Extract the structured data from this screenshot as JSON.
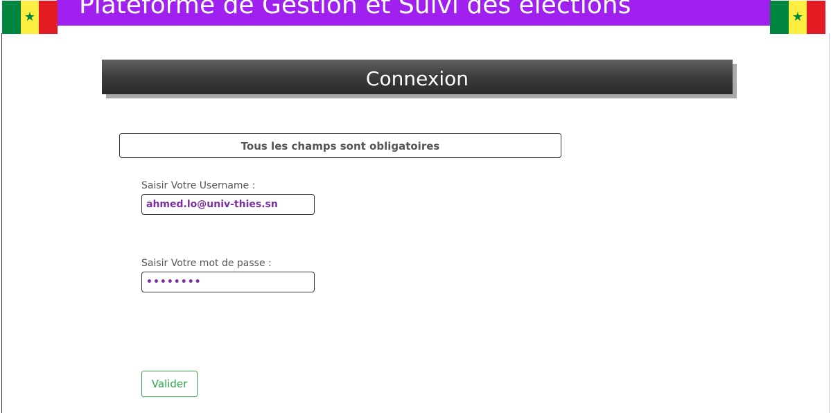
{
  "header": {
    "title": "Plateforme de Gestion et Suivi des élections",
    "bar_color": "#a020f0",
    "flags": [
      {
        "name": "senegal-flag",
        "colors": [
          "#00853f",
          "#fdef42",
          "#e31b23"
        ],
        "star": "★"
      },
      {
        "name": "senegal-flag",
        "colors": [
          "#00853f",
          "#fdef42",
          "#e31b23"
        ],
        "star": "★"
      }
    ]
  },
  "login": {
    "heading": "Connexion",
    "notice": "Tous les champs sont obligatoires",
    "username": {
      "label": "Saisir Votre Username :",
      "value": "ahmed.lo@univ-thies.sn"
    },
    "password": {
      "label": "Saisir Votre mot de passe :",
      "value": "abcdefgh"
    },
    "submit_label": "Valider"
  },
  "colors": {
    "input_text": "#7b2fa0",
    "button_accent": "#28a745"
  }
}
